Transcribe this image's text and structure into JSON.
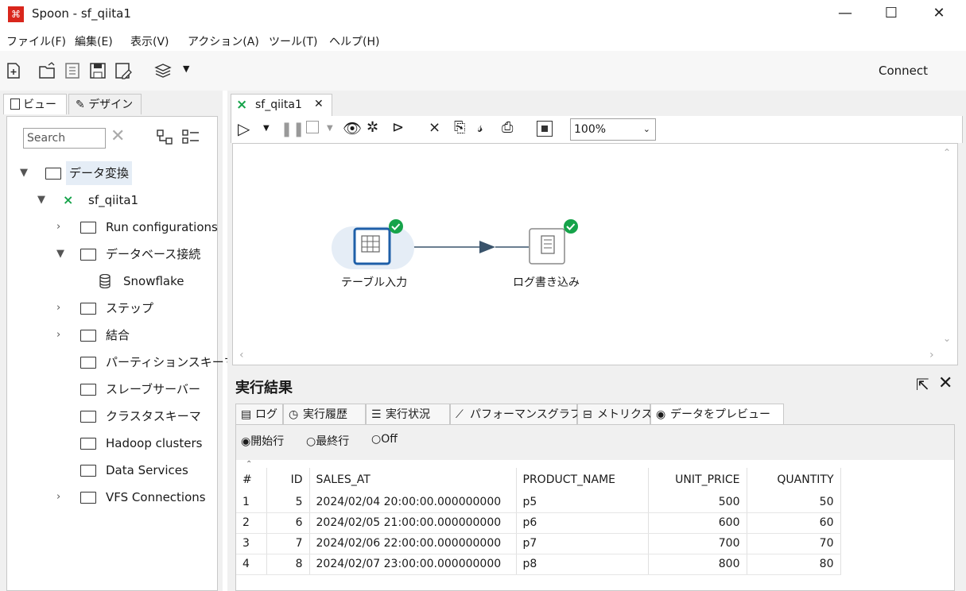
{
  "window": {
    "title": "Spoon - sf_qiita1"
  },
  "menu": [
    "ファイル(F)",
    "編集(E)",
    "表示(V)",
    "アクション(A)",
    "ツール(T)",
    "ヘルプ(H)"
  ],
  "toolbar": {
    "connect_label": "Connect"
  },
  "left_panel": {
    "tabs": [
      "ビュー",
      "デザイン"
    ],
    "search_placeholder": "Search",
    "tree": {
      "root": "データ変換",
      "transformation": "sf_qiita1",
      "items": [
        "Run configurations",
        "データベース接続",
        "Snowflake",
        "ステップ",
        "結合",
        "パーティションスキーマ",
        "スレーブサーバー",
        "クラスタスキーマ",
        "Hadoop clusters",
        "Data Services",
        "VFS Connections"
      ]
    }
  },
  "editor": {
    "tab_label": "sf_qiita1",
    "zoom": "100%",
    "steps": [
      {
        "label": "テーブル入力"
      },
      {
        "label": "ログ書き込み"
      }
    ]
  },
  "results": {
    "title": "実行結果",
    "tabs": [
      "ログ",
      "実行履歴",
      "実行状況",
      "パフォーマンスグラフ",
      "メトリクス",
      "データをプレビュー"
    ],
    "radio": {
      "first": "開始行",
      "last": "最終行",
      "off": "Off",
      "selected": "開始行"
    },
    "columns": [
      "#",
      "ID",
      "SALES_AT",
      "PRODUCT_NAME",
      "UNIT_PRICE",
      "QUANTITY"
    ],
    "rows": [
      [
        "1",
        "5",
        "2024/02/04 20:00:00.000000000",
        "p5",
        "500",
        "50"
      ],
      [
        "2",
        "6",
        "2024/02/05 21:00:00.000000000",
        "p6",
        "600",
        "60"
      ],
      [
        "3",
        "7",
        "2024/02/06 22:00:00.000000000",
        "p7",
        "700",
        "70"
      ],
      [
        "4",
        "8",
        "2024/02/07 23:00:00.000000000",
        "p8",
        "800",
        "80"
      ]
    ]
  },
  "colors": {
    "accent": "#1e5fa8",
    "success": "#16a34a",
    "app_red": "#d9261c",
    "selection": "#e5edf6"
  }
}
